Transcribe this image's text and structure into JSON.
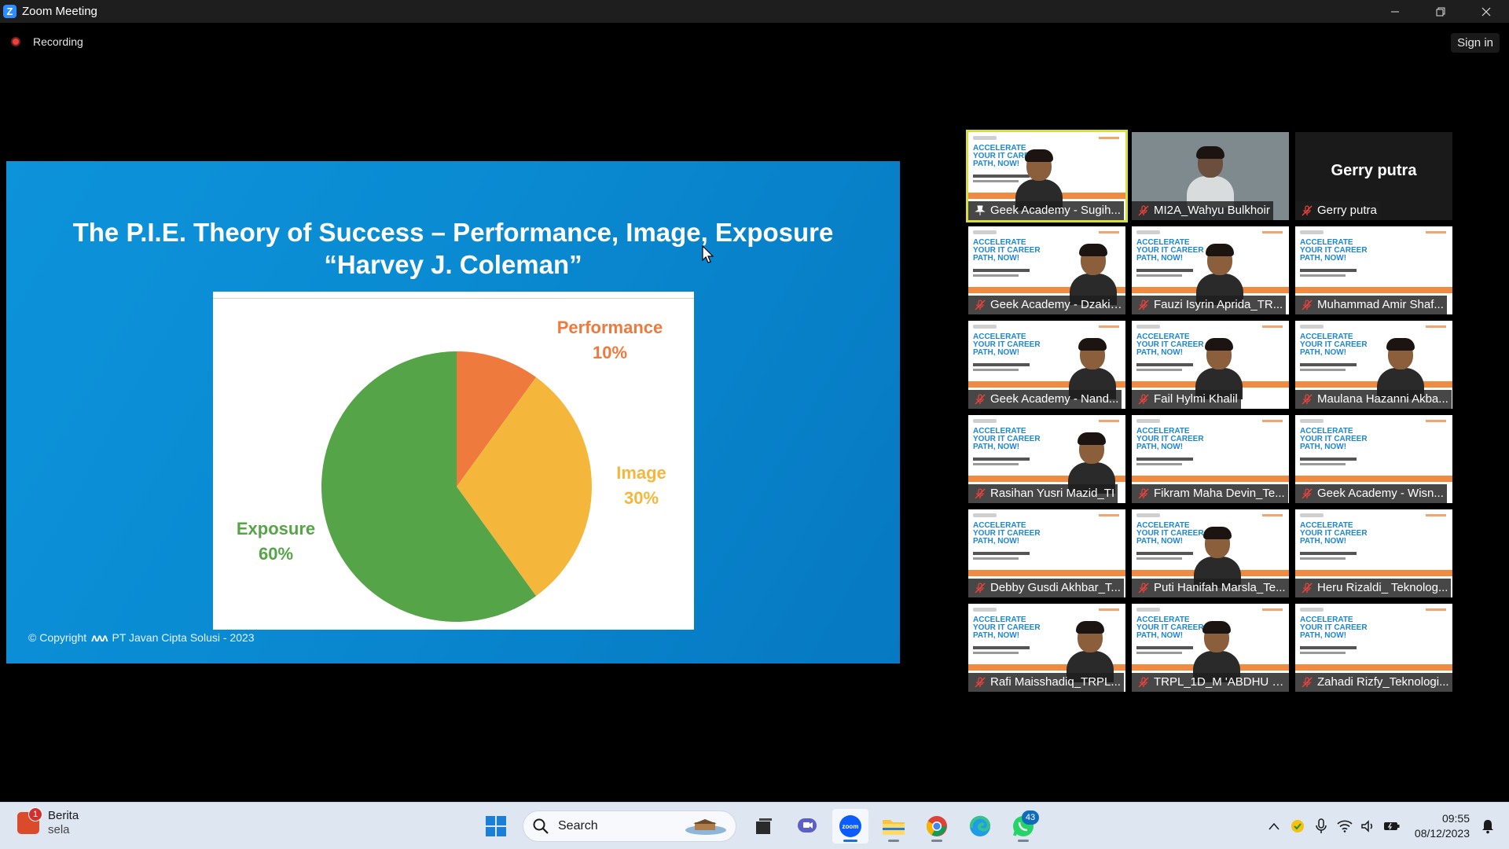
{
  "window": {
    "title": "Zoom Meeting",
    "recording_label": "Recording",
    "sign_in_label": "Sign in"
  },
  "slide": {
    "title_line1": "The P.I.E. Theory of Success – Performance, Image, Exposure",
    "title_line2": "“Harvey J. Coleman”",
    "copyright_prefix": "© Copyright",
    "copyright_text": "PT Javan Cipta Solusi - 2023",
    "colors": {
      "performance": "#ef7a3d",
      "image": "#f5b73b",
      "exposure": "#55a447"
    }
  },
  "chart_data": {
    "type": "pie",
    "title": "The P.I.E. Theory of Success – Performance, Image, Exposure",
    "slices": [
      {
        "label": "Performance",
        "value": 10,
        "display": "10%"
      },
      {
        "label": "Image",
        "value": 30,
        "display": "30%"
      },
      {
        "label": "Exposure",
        "value": 60,
        "display": "60%"
      }
    ]
  },
  "gallery": {
    "participants": [
      {
        "name": "Geek Academy - Sugih...",
        "video": "banner-person",
        "active": true,
        "pinned": true
      },
      {
        "name": "MI2A_Wahyu Bulkhoir",
        "video": "camera"
      },
      {
        "name": "Gerry putra",
        "video": "off",
        "big_name": "Gerry putra"
      },
      {
        "name": "Geek Academy - Dzaki ...",
        "video": "banner-person"
      },
      {
        "name": "Fauzi Isyrin Aprida_TR...",
        "video": "banner-person"
      },
      {
        "name": "Muhammad Amir Shaf...",
        "video": "banner"
      },
      {
        "name": "Geek Academy - Nand...",
        "video": "banner-person"
      },
      {
        "name": "Fail Hylmi Khalil",
        "video": "banner-person"
      },
      {
        "name": "Maulana Hazanni Akba...",
        "video": "banner-person"
      },
      {
        "name": "Rasihan Yusri Mazid_TI",
        "video": "banner-person"
      },
      {
        "name": "Fikram Maha Devin_Te...",
        "video": "banner"
      },
      {
        "name": "Geek Academy - Wisn...",
        "video": "banner"
      },
      {
        "name": "Debby Gusdi Akhbar_T...",
        "video": "banner"
      },
      {
        "name": "Puti Hanifah Marsla_Te...",
        "video": "banner-person"
      },
      {
        "name": "Heru Rizaldi_ Teknolog...",
        "video": "banner"
      },
      {
        "name": "Rafi Maisshadiq_TRPL...",
        "video": "banner-person"
      },
      {
        "name": "TRPL_1D_M 'ABDHU S...",
        "video": "banner-person"
      },
      {
        "name": "Zahadi Rizfy_Teknologi...",
        "video": "banner"
      }
    ],
    "banner_text": "ACCELERATE\nYOUR IT CAREER\nPATH, NOW!"
  },
  "taskbar": {
    "news_badge": "1",
    "news_title": "Berita",
    "news_sub": "sela",
    "search_label": "Search",
    "whatsapp_badge": "43",
    "time": "09:55",
    "date": "08/12/2023",
    "accent": "#0f6cbd"
  }
}
